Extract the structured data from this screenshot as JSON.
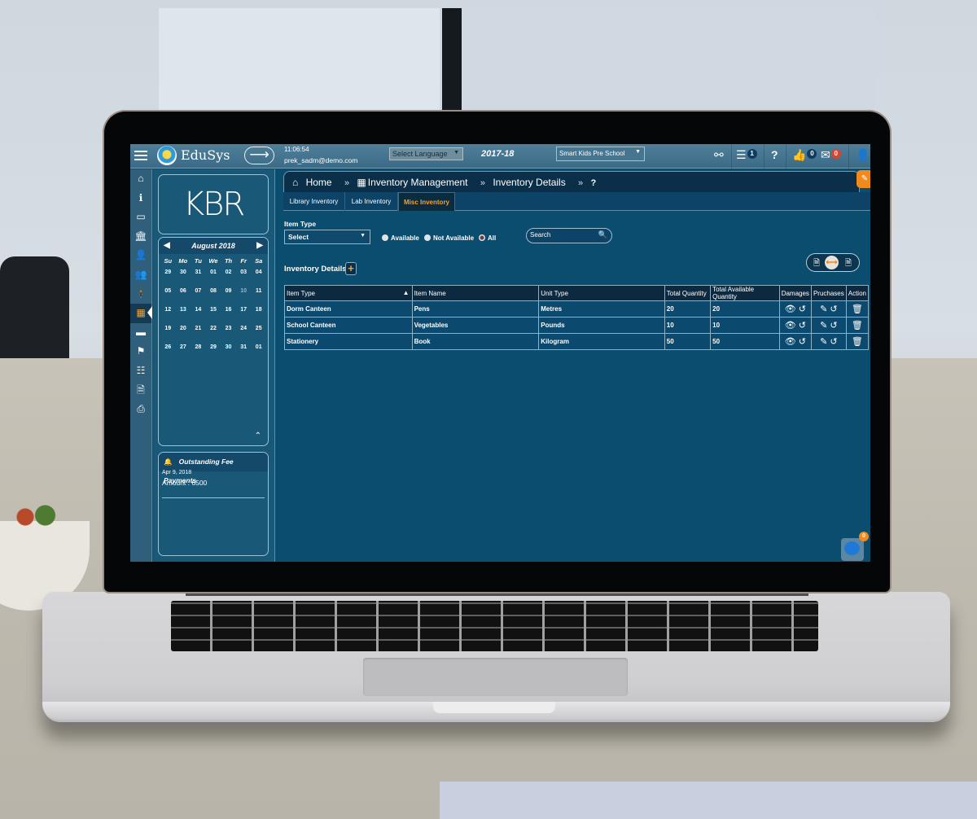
{
  "header": {
    "brand": "EduSys",
    "time": "11:06:54",
    "user_email": "prek_sadm@demo.com",
    "language_select": "Select Language",
    "academic_year": "2017-18",
    "school_select": "Smart Kids Pre School",
    "icons": [
      {
        "name": "link-icon",
        "glyph": "⚯",
        "badge": null
      },
      {
        "name": "list-icon",
        "glyph": "☰",
        "badge": "1"
      },
      {
        "name": "help-icon",
        "glyph": "?",
        "badge": null
      },
      {
        "name": "like-icon",
        "glyph": "👍",
        "badge": "0"
      },
      {
        "name": "mail-icon",
        "glyph": "✉",
        "badge": "0"
      },
      {
        "name": "user-icon",
        "glyph": "👤",
        "badge": null
      }
    ]
  },
  "rail": {
    "items": [
      {
        "name": "home-icon",
        "glyph": "⌂"
      },
      {
        "name": "info-icon",
        "glyph": "ℹ"
      },
      {
        "name": "monitor-icon",
        "glyph": "▭"
      },
      {
        "name": "institution-icon",
        "glyph": "🏛"
      },
      {
        "name": "add-user-icon",
        "glyph": "👤"
      },
      {
        "name": "users-icon",
        "glyph": "👥"
      },
      {
        "name": "person-icon",
        "glyph": "🕴"
      },
      {
        "name": "calculator-icon",
        "glyph": "▦",
        "active": true
      },
      {
        "name": "card-icon",
        "glyph": "▬"
      },
      {
        "name": "flag-icon",
        "glyph": "⚑"
      },
      {
        "name": "list-icon",
        "glyph": "☷"
      },
      {
        "name": "document-icon",
        "glyph": "🗎"
      },
      {
        "name": "print-icon",
        "glyph": "⎙"
      }
    ]
  },
  "side": {
    "logo_text": "KBR",
    "calendar": {
      "month_label": "August 2018",
      "days_of_week": [
        "Su",
        "Mo",
        "Tu",
        "We",
        "Th",
        "Fr",
        "Sa"
      ],
      "days": [
        "29",
        "30",
        "31",
        "01",
        "02",
        "03",
        "04",
        "05",
        "06",
        "07",
        "08",
        "09",
        "10",
        "11",
        "12",
        "13",
        "14",
        "15",
        "16",
        "17",
        "18",
        "19",
        "20",
        "21",
        "22",
        "23",
        "24",
        "25",
        "26",
        "27",
        "28",
        "29",
        "30",
        "31",
        "01"
      ],
      "today": "10"
    },
    "fee_panel": {
      "title": "Outstanding Fee Payments",
      "date": "Apr 9, 2018",
      "amount": "Amount : 6500"
    }
  },
  "breadcrumb": {
    "home": "Home",
    "module": "Inventory Management",
    "page": "Inventory Details",
    "help": "?"
  },
  "tabs": [
    {
      "label": "Library Inventory",
      "active": false
    },
    {
      "label": "Lab Inventory",
      "active": false
    },
    {
      "label": "Misc Inventory",
      "active": true
    }
  ],
  "filters": {
    "item_type_label": "Item Type",
    "item_type_value": "Select",
    "radios": [
      {
        "label": "Available",
        "checked": false
      },
      {
        "label": "Not Available",
        "checked": false
      },
      {
        "label": "All",
        "checked": true
      }
    ],
    "search_placeholder": "Search"
  },
  "inventory": {
    "title": "Inventory Details",
    "add_label": "+",
    "columns": [
      "Item Type",
      "Item Name",
      "Unit Type",
      "Total Quantity",
      "Total Available Quantity",
      "Damages",
      "Pruchases",
      "Action"
    ],
    "rows": [
      {
        "item_type": "Dorm Canteen",
        "item_name": "Pens",
        "unit_type": "Metres",
        "total_qty": "20",
        "available_qty": "20"
      },
      {
        "item_type": "School Canteen",
        "item_name": "Vegetables",
        "unit_type": "Pounds",
        "total_qty": "10",
        "available_qty": "10"
      },
      {
        "item_type": "Stationery",
        "item_name": "Book",
        "unit_type": "Kilogram",
        "total_qty": "50",
        "available_qty": "50"
      }
    ]
  },
  "chat": {
    "badge": "0"
  },
  "colors": {
    "accent_orange": "#f08a1f",
    "panel_blue": "#0a4d6f",
    "header_blue": "#0c2f49",
    "badge_red": "#d8452f"
  }
}
